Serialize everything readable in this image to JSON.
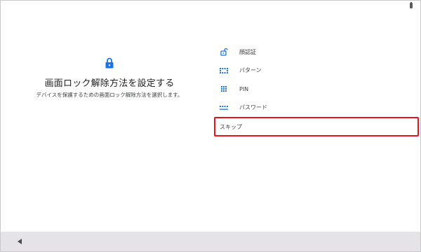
{
  "header": {
    "title": "画面ロック解除方法を設定する",
    "subtitle": "デバイスを保護するための画面ロック解除方法を選択します。"
  },
  "options": [
    {
      "label": "顔認証",
      "icon": "face-unlock-icon"
    },
    {
      "label": "パターン",
      "icon": "pattern-icon"
    },
    {
      "label": "PIN",
      "icon": "pin-icon"
    },
    {
      "label": "パスワード",
      "icon": "password-icon"
    },
    {
      "label": "スキップ",
      "icon": ""
    }
  ],
  "colors": {
    "accent": "#1a73e8",
    "highlight_border": "#e8141c",
    "nav_bar": "#e6e3e8"
  }
}
